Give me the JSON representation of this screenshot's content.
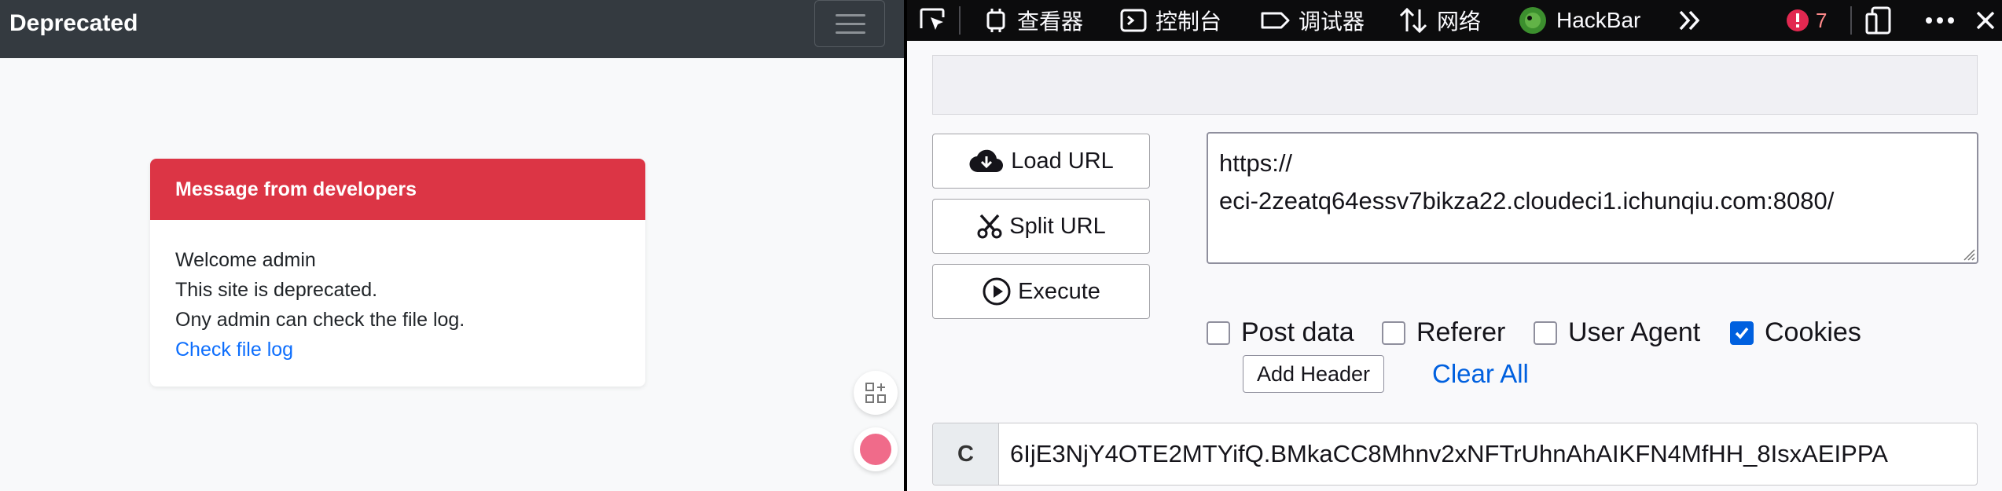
{
  "site": {
    "brand": "Deprecated",
    "card": {
      "header": "Message from developers",
      "lines": [
        "Welcome admin",
        "This site is deprecated.",
        "Ony admin can check the file log."
      ],
      "link": "Check file log"
    }
  },
  "devtools": {
    "tabs": [
      {
        "icon": "inspector-icon",
        "label": "查看器"
      },
      {
        "icon": "console-icon",
        "label": "控制台"
      },
      {
        "icon": "debugger-icon",
        "label": "调试器"
      },
      {
        "icon": "network-icon",
        "label": "网络"
      },
      {
        "icon": "hackbar-icon",
        "label": "HackBar"
      }
    ],
    "error_count": "7"
  },
  "hackbar": {
    "buttons": {
      "load": "Load URL",
      "split": "Split URL",
      "execute": "Execute"
    },
    "url_line1": "https://",
    "url_line2": "eci-2zeatq64essv7bikza22.cloudeci1.ichunqiu.com:8080/",
    "options": [
      {
        "label": "Post data",
        "checked": false
      },
      {
        "label": "Referer",
        "checked": false
      },
      {
        "label": "User Agent",
        "checked": false
      },
      {
        "label": "Cookies",
        "checked": true
      }
    ],
    "add_header": "Add Header",
    "clear_all": "Clear All",
    "cookie_label": "C",
    "cookie_value": "6IjE3NjY4OTE2MTYifQ.BMkaCC8Mhnv2xNFTrUhnAhAIKFN4MfHH_8IsxAEIPPA"
  },
  "colors": {
    "danger": "#dc3545",
    "link": "#0d6efd",
    "navbar": "#343a40",
    "devtools_bg": "#0c0c0d",
    "accent": "#0060df"
  }
}
